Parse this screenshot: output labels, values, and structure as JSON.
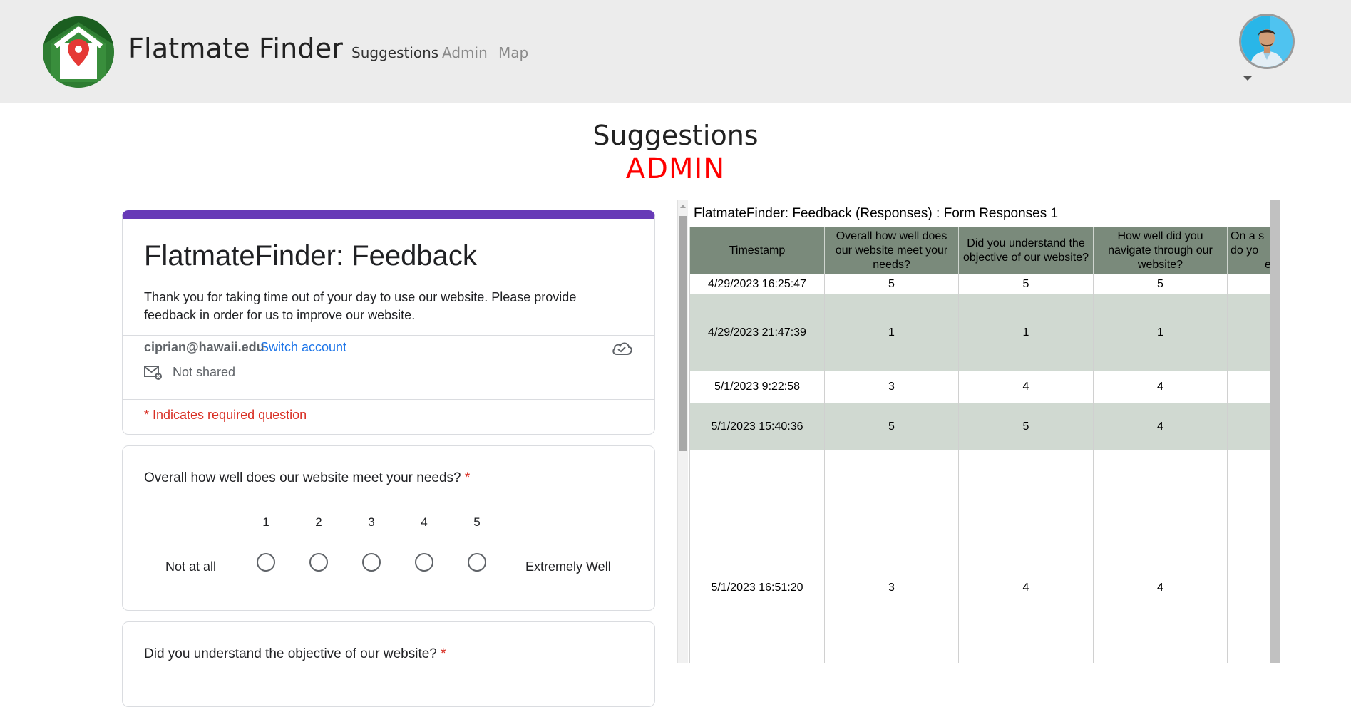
{
  "app": {
    "brand": "Flatmate Finder"
  },
  "nav": {
    "links": [
      {
        "label": "Suggestions",
        "active": true
      },
      {
        "label": "Admin",
        "active": false
      },
      {
        "label": "Map",
        "active": false
      }
    ]
  },
  "page": {
    "title": "Suggestions",
    "subtitle": "ADMIN"
  },
  "colors": {
    "form_accent": "#673ab7",
    "admin_red": "#ff0000",
    "link_blue": "#1a73e8",
    "required_red": "#d93025",
    "sheet_header": "#7a8a7b",
    "sheet_shade": "#d0d9d1"
  },
  "form": {
    "title": "FlatmateFinder: Feedback",
    "description": "Thank you for taking time out of your day to use our website. Please provide feedback in order for us to improve our website.",
    "account_email": "ciprian@hawaii.edu",
    "switch_account": "Switch account",
    "not_shared": "Not shared",
    "required_note": "* Indicates required question",
    "questions": [
      {
        "text": "Overall how well does our website meet your needs?",
        "required_mark": "*",
        "scale": [
          "1",
          "2",
          "3",
          "4",
          "5"
        ],
        "low_label": "Not at all",
        "high_label": "Extremely Well"
      },
      {
        "text": "Did you understand the objective of our website?",
        "required_mark": "*"
      }
    ]
  },
  "sheet": {
    "title": "FlatmateFinder: Feedback (Responses) : Form Responses 1",
    "headers": [
      "Timestamp",
      "Overall how well does our website meet your needs?",
      "Did you understand the objective of our website?",
      "How well did you navigate through our website?",
      "On a s do yo e"
    ],
    "header_partial": [
      "On a s",
      "do yo",
      "e"
    ],
    "rows": [
      {
        "timestamp": "4/29/2023 16:25:47",
        "q1": "5",
        "q2": "5",
        "q3": "5",
        "q4": ""
      },
      {
        "timestamp": "4/29/2023 21:47:39",
        "q1": "1",
        "q2": "1",
        "q3": "1",
        "q4": ""
      },
      {
        "timestamp": "5/1/2023 9:22:58",
        "q1": "3",
        "q2": "4",
        "q3": "4",
        "q4": ""
      },
      {
        "timestamp": "5/1/2023 15:40:36",
        "q1": "5",
        "q2": "5",
        "q3": "4",
        "q4": ""
      },
      {
        "timestamp": "5/1/2023 16:51:20",
        "q1": "3",
        "q2": "4",
        "q3": "4",
        "q4": ""
      }
    ]
  },
  "icons": {
    "logo": "house-pin-logo",
    "avatar": "user-avatar",
    "cloud": "cloud-check-icon",
    "mail": "mail-off-icon"
  }
}
